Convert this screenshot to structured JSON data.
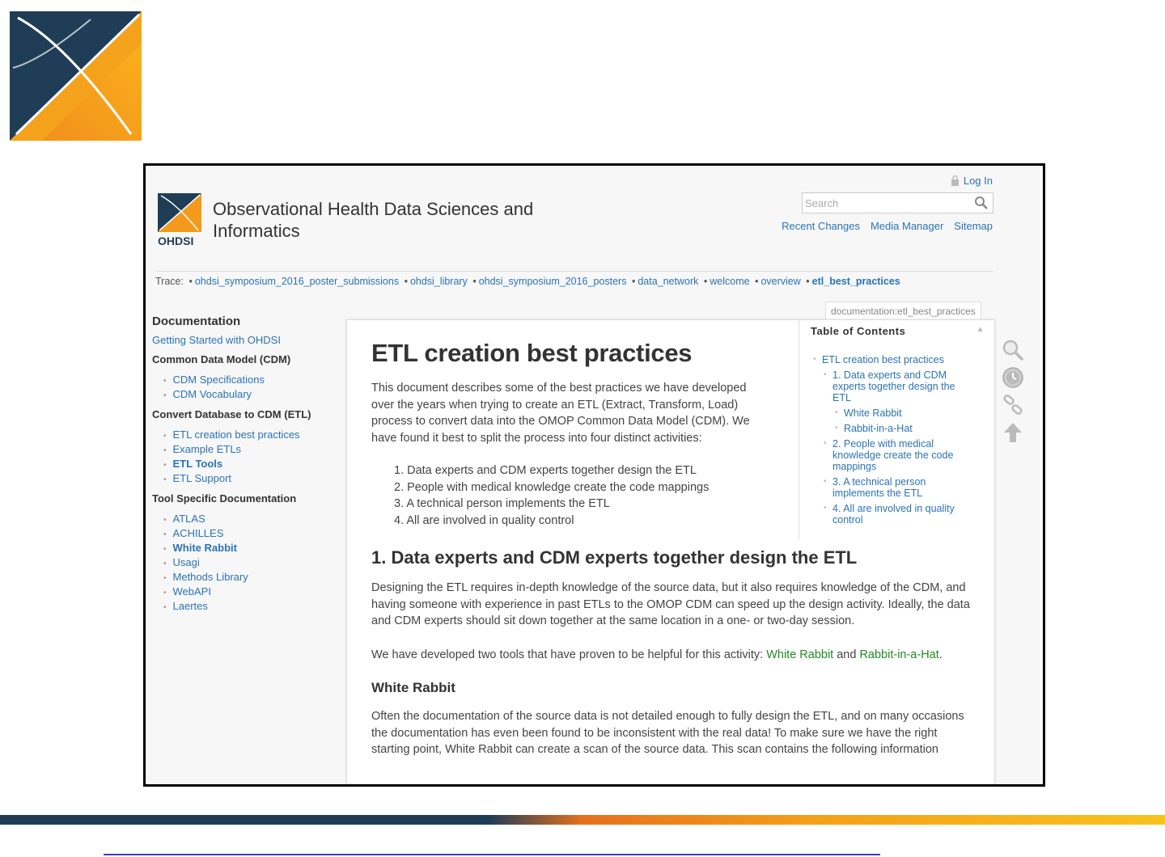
{
  "site": {
    "title": "Observational Health Data Sciences and Informatics",
    "logo_text": "OHDSI"
  },
  "header": {
    "login_label": "Log In",
    "search_placeholder": "Search",
    "links": [
      "Recent Changes",
      "Media Manager",
      "Sitemap"
    ]
  },
  "trace": {
    "label": "Trace:",
    "items": [
      "ohdsi_symposium_2016_poster_submissions",
      "ohdsi_library",
      "ohdsi_symposium_2016_posters",
      "data_network",
      "welcome",
      "overview"
    ],
    "current": "etl_best_practices"
  },
  "sidebar": {
    "heading": "Documentation",
    "getting_started": "Getting Started with OHDSI",
    "sections": [
      {
        "title": "Common Data Model (CDM)",
        "items": [
          "CDM Specifications",
          "CDM Vocabulary"
        ]
      },
      {
        "title": "Convert Database to CDM (ETL)",
        "items": [
          "ETL creation best practices",
          "Example ETLs",
          "ETL Tools",
          "ETL Support"
        ]
      },
      {
        "title": "Tool Specific Documentation",
        "items": [
          "ATLAS",
          "ACHILLES",
          "White Rabbit",
          "Usagi",
          "Methods Library",
          "WebAPI",
          "Laertes"
        ]
      }
    ]
  },
  "page_id": "documentation:etl_best_practices",
  "toc": {
    "title": "Table of Contents",
    "toggle": "▲",
    "items": [
      "ETL creation best practices",
      "1. Data experts and CDM experts together design the ETL",
      "White Rabbit",
      "Rabbit-in-a-Hat",
      "2. People with medical knowledge create the code mappings",
      "3. A technical person implements the ETL",
      "4. All are involved in quality control"
    ]
  },
  "article": {
    "title": "ETL creation best practices",
    "intro": "This document describes some of the best practices we have developed over the years when trying to create an ETL (Extract, Transform, Load) process to convert data into the OMOP Common Data Model (CDM). We have found it best to split the process into four distinct activities:",
    "steps": [
      "1. Data experts and CDM experts together design the ETL",
      "2. People with medical knowledge create the code mappings",
      "3. A technical person implements the ETL",
      "4. All are involved in quality control"
    ],
    "section1_title": "1. Data experts and CDM experts together design the ETL",
    "section1_p1": "Designing the ETL requires in-depth knowledge of the source data, but it also requires knowledge of the CDM, and having someone with experience in past ETLs to the OMOP CDM can speed up the design activity. Ideally, the data and CDM experts should sit down together at the same location in a one- or two-day session.",
    "section1_p2_prefix": "We have developed two tools that have proven to be helpful for this activity: ",
    "section1_p2_link1": "White Rabbit",
    "section1_p2_and": " and ",
    "section1_p2_link2": "Rabbit-in-a-Hat",
    "section1_p2_suffix": ".",
    "wr_title": "White Rabbit",
    "wr_p": "Often the documentation of the source data is not detailed enough to fully design the ETL, and on many occasions the documentation has even been found to be inconsistent with the real data! To make sure we have the right starting point, White Rabbit can create a scan of the source data. This scan contains the following information"
  },
  "colors": {
    "link": "#2b73b7",
    "internal_link": "#228b22",
    "navy": "#1f3d57",
    "orange": "#f4a018"
  },
  "icons": [
    "ohdsi-logo",
    "lock-icon",
    "search-icon",
    "magnifier-tool-icon",
    "clock-icon",
    "link-icon",
    "arrow-up-icon"
  ]
}
